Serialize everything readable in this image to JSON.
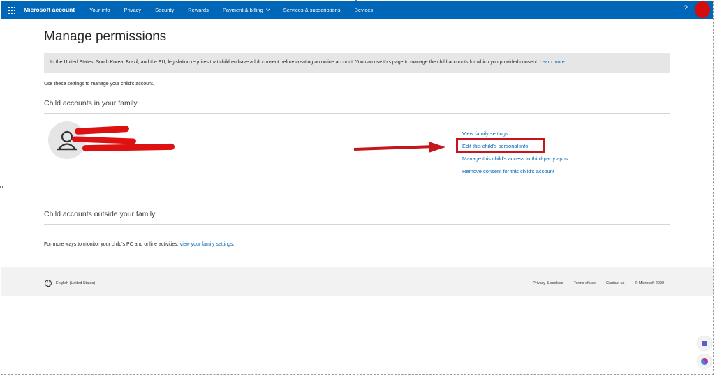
{
  "header": {
    "brand": "Microsoft account",
    "nav": [
      "Your info",
      "Privacy",
      "Security",
      "Rewards",
      "Payment & billing",
      "Services & subscriptions",
      "Devices"
    ],
    "help": "?"
  },
  "page": {
    "title": "Manage permissions",
    "notice": "In the United States, South Korea, Brazil, and the EU, legislation requires that children have adult consent before creating an online account. You can use this page to manage the child accounts for which you provided consent.",
    "notice_link": "Learn more.",
    "intro": "Use these settings to manage your child's account.",
    "section_in_family": "Child accounts in your family",
    "child_actions": [
      "View family settings",
      "Edit this child's personal info",
      "Manage this child's access to third-party apps",
      "Remove consent for this child's account"
    ],
    "section_outside_family": "Child accounts outside your family",
    "more_text": "For more ways to monitor your child's PC and online activities,",
    "more_link": "view your family settings."
  },
  "footer": {
    "language": "English (United States)",
    "links": [
      "Privacy & cookies",
      "Terms of use",
      "Contact us",
      "© Microsoft 2020"
    ]
  },
  "colors": {
    "nav_bg": "#0067b8",
    "link": "#0067b8",
    "annotation_red": "#c4161c"
  }
}
